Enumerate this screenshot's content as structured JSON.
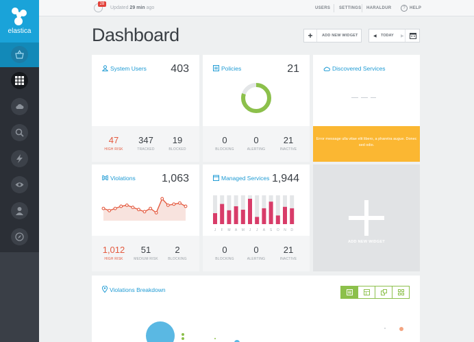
{
  "brand": {
    "name": "elastica",
    "color": "#1aa3d9"
  },
  "sidebar": {
    "items": [
      {
        "icon": "basket-icon",
        "active": true
      },
      {
        "icon": "grid-icon"
      },
      {
        "icon": "cloud-icon"
      },
      {
        "icon": "search-icon"
      },
      {
        "icon": "lightning-icon"
      },
      {
        "icon": "eye-icon"
      },
      {
        "icon": "user-icon"
      },
      {
        "icon": "compass-icon"
      }
    ]
  },
  "topbar": {
    "notification_count": "28",
    "updated_prefix": "Updated",
    "updated_time": "29 min",
    "updated_suffix": "ago",
    "nav": [
      "USERS",
      "SETTINGS",
      "HARALDUR"
    ],
    "help_label": "HELP"
  },
  "header": {
    "title": "Dashboard",
    "add_widget_label": "ADD NEW WIDGET",
    "today_label": "TODAY"
  },
  "cards": {
    "system_users": {
      "title": "System Users",
      "total": "403",
      "stats": [
        {
          "value": "47",
          "label": "HIGH RISK",
          "highlight": true
        },
        {
          "value": "347",
          "label": "TRACKED"
        },
        {
          "value": "19",
          "label": "BLOCKED"
        }
      ]
    },
    "policies": {
      "title": "Policies",
      "total": "21",
      "donut_fraction": 0.8,
      "stats": [
        {
          "value": "0",
          "label": "BLOCKING"
        },
        {
          "value": "0",
          "label": "ALERTING"
        },
        {
          "value": "21",
          "label": "INACTIVE"
        }
      ]
    },
    "discovered_services": {
      "title": "Discovered Services",
      "error_message": "Error message ulla vitae elit libero, a pharetra augue. Donec sed odio."
    },
    "violations": {
      "title": "Violations",
      "total": "1,063",
      "trend": [
        5,
        3,
        5,
        7,
        8,
        6,
        4,
        2,
        5,
        1,
        14,
        8,
        9,
        10,
        7
      ],
      "stats": [
        {
          "value": "1,012",
          "label": "HIGH RISK",
          "highlight": true
        },
        {
          "value": "51",
          "label": "MEDIUM RISK"
        },
        {
          "value": "2",
          "label": "BLOCKING"
        }
      ]
    },
    "managed_services": {
      "title": "Managed Services",
      "total": "1,944",
      "months": [
        "J",
        "F",
        "M",
        "A",
        "M",
        "J",
        "J",
        "A",
        "S",
        "O",
        "N",
        "D"
      ],
      "bars": [
        0.38,
        0.7,
        0.48,
        0.62,
        0.5,
        0.88,
        0.25,
        0.55,
        0.78,
        0.3,
        0.6,
        0.55
      ],
      "stats": [
        {
          "value": "0",
          "label": "BLOCKING"
        },
        {
          "value": "0",
          "label": "ALERTING"
        },
        {
          "value": "21",
          "label": "INACTIVE"
        }
      ]
    },
    "add_widget": {
      "label": "ADD NEW WIDGET"
    },
    "violations_breakdown": {
      "title": "Violations Breakdown"
    }
  },
  "colors": {
    "accent_blue": "#1f9bd4",
    "risk_red": "#e45a3f",
    "donut_green": "#8cc04b",
    "bar_pink": "#d83c69",
    "warning_yellow": "#fbb732",
    "sidebar_dark": "#2b2f36"
  }
}
